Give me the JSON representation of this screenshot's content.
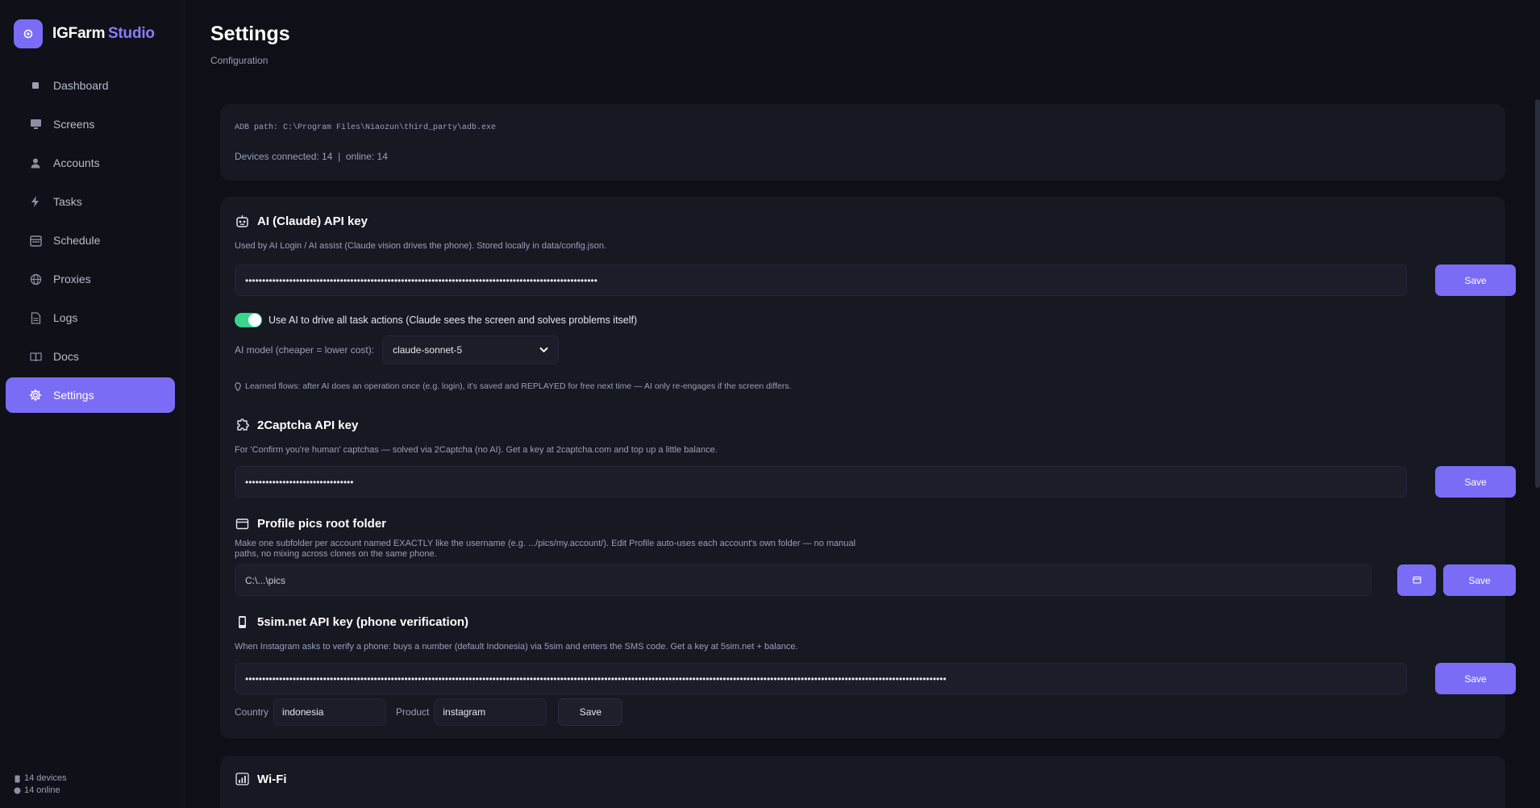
{
  "brand": {
    "name": "IGFarm",
    "accent": "Studio",
    "accent_color": "#7b6cf6"
  },
  "sidebar": {
    "items": [
      {
        "label": "Dashboard",
        "icon": "square-icon"
      },
      {
        "label": "Screens",
        "icon": "monitor-icon"
      },
      {
        "label": "Accounts",
        "icon": "user-icon"
      },
      {
        "label": "Tasks",
        "icon": "bolt-icon"
      },
      {
        "label": "Schedule",
        "icon": "calendar-icon"
      },
      {
        "label": "Proxies",
        "icon": "globe-icon"
      },
      {
        "label": "Logs",
        "icon": "document-icon"
      },
      {
        "label": "Docs",
        "icon": "book-icon"
      },
      {
        "label": "Settings",
        "icon": "gear-icon",
        "active": true
      }
    ],
    "footer": {
      "devices": "14 devices",
      "online": "14 online"
    }
  },
  "page": {
    "title": "Settings",
    "subtitle": "Configuration"
  },
  "adb": {
    "path_text": "ADB path: C:\\Program Files\\Niaozun\\third_party\\adb.exe",
    "status_text": "Devices connected: 14  |  online: 14"
  },
  "ai": {
    "title": "AI (Claude) API key",
    "description": "Used by AI Login / AI assist (Claude vision drives the phone). Stored locally in data/config.json.",
    "key_value": "••••••••••••••••••••••••••••••••••••••••••••••••••••••••••••••••••••••••••••••••••••••••••••••••••••••••",
    "save_label": "Save",
    "toggle_label": "Use AI to drive all task actions (Claude sees the screen and solves problems itself)",
    "toggle_on": true,
    "model_label": "AI model (cheaper = lower cost):",
    "model_value": "claude-sonnet-5",
    "learned_text": "Learned flows: after AI does an operation once (e.g. login), it's saved and REPLAYED for free next time — AI only re-engages if the screen differs."
  },
  "captcha": {
    "title": "2Captcha API key",
    "description": "For 'Confirm you're human' captchas — solved via 2Captcha (no AI). Get a key at 2captcha.com and top up a little balance.",
    "key_value": "••••••••••••••••••••••••••••••••",
    "save_label": "Save"
  },
  "profile_pics": {
    "title": "Profile pics root folder",
    "description_line1": "Make one subfolder per account named EXACTLY like the username (e.g. .../pics/my.account/). Edit Profile auto-uses each account's own folder — no manual",
    "description_line2": "paths, no mixing across clones on the same phone.",
    "folder_value": "C:\\...\\pics",
    "save_label": "Save"
  },
  "fivesim": {
    "title": "5sim.net API key (phone verification)",
    "description": "When Instagram asks to verify a phone: buys a number (default Indonesia) via 5sim and enters the SMS code. Get a key at 5sim.net + balance.",
    "key_value": "•••••••••••••••••••••••••••••••••••••••••••••••••••••••••••••••••••••••••••••••••••••••••••••••••••••••••••••••••••••••••••••••••••••••••••••••••••••••••••••••••••••••••••••••••••••••••••••••••••••••••••••••",
    "save_label": "Save",
    "country_label": "Country",
    "country_value": "indonesia",
    "product_label": "Product",
    "product_value": "instagram",
    "save2_label": "Save"
  },
  "wifi": {
    "title": "Wi-Fi"
  }
}
